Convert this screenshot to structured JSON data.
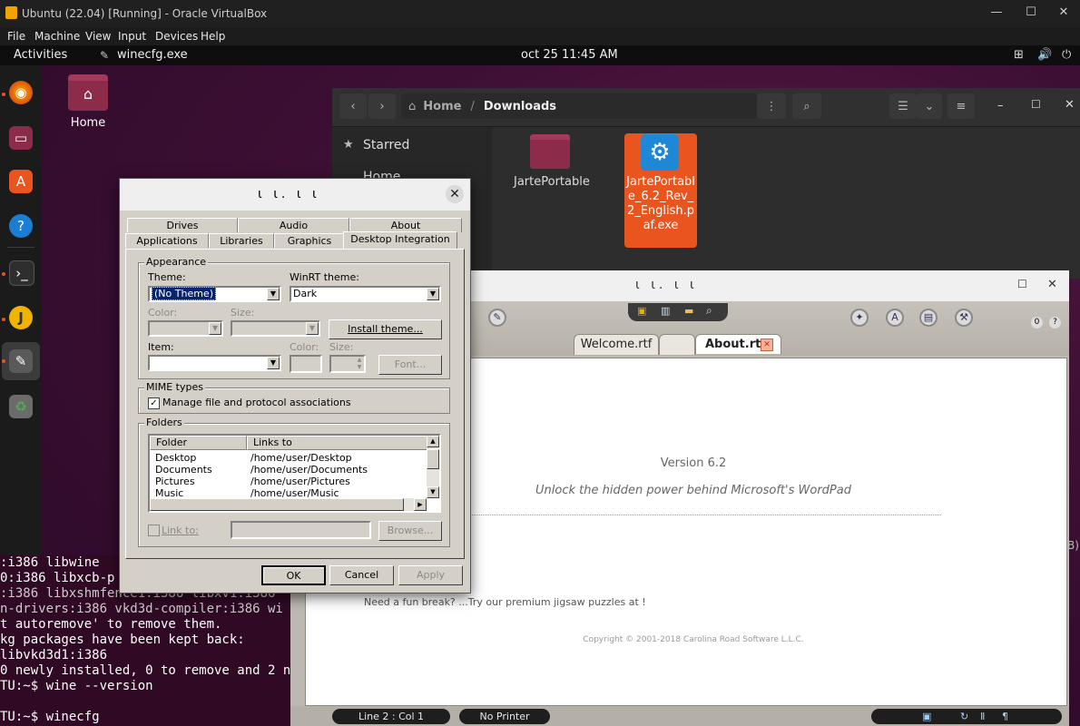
{
  "vbox": {
    "title": "Ubuntu (22.04) [Running] - Oracle VirtualBox",
    "menu": [
      "File",
      "Machine",
      "View",
      "Input",
      "Devices",
      "Help"
    ],
    "controls": {
      "minimize": "—",
      "maximize": "☐",
      "close": "✕"
    }
  },
  "gnome": {
    "activities": "Activities",
    "app_name": "winecfg.exe",
    "clock": "oct 25  11:45 AM",
    "tray": {
      "network": "⊞",
      "volume": "🔊",
      "power": "⏻"
    }
  },
  "desktop": {
    "home_label": "Home"
  },
  "terminal": {
    "lines": [
      ":i386 libwine",
      "0:i386 libxcb-p",
      ":i386 libxshmfence1:i386 libxv1:i386",
      "n-drivers:i386 vkd3d-compiler:i386 wi",
      "t autoremove' to remove them.",
      "kg packages have been kept back:",
      "libvkd3d1:i386",
      "0 newly installed, 0 to remove and 2 n",
      "TU:~$ wine --version",
      "",
      "TU:~$ winecfg"
    ]
  },
  "nautilus": {
    "breadcrumb_home": "Home",
    "breadcrumb_sep": "/",
    "breadcrumb_current": "Downloads",
    "sidebar": {
      "starred": "Starred",
      "home": "Home"
    },
    "files": [
      {
        "name": "JartePortable",
        "type": "folder"
      },
      {
        "name": "JartePortable_6.2_Rev_2_English.paf.exe",
        "type": "exe",
        "selected": true
      }
    ]
  },
  "jarte": {
    "title": "ι ι. ι ι",
    "tabs": [
      "Welcome.rtf",
      "",
      "About.rtf"
    ],
    "version": "Version 6.2",
    "tagline": "Unlock the hidden power behind Microsoft's WordPad",
    "fun_break": "Need a fun break?  ...Try our premium jigsaw puzzles at !",
    "copyright": "Copyright © 2001-2018 Carolina Road Software L.L.C.",
    "status_line": "Line 2 : Col 1",
    "status_printer": "No Printer",
    "side_fragment": "B)"
  },
  "winecfg": {
    "title": "ι ι. ι ι",
    "tabs_row1": [
      "Drives",
      "Audio",
      "About"
    ],
    "tabs_row2": [
      "Applications",
      "Libraries",
      "Graphics",
      "Desktop Integration"
    ],
    "active_tab": "Desktop Integration",
    "appearance": {
      "group": "Appearance",
      "theme_label": "Theme:",
      "theme_value": "(No Theme)",
      "winrt_label": "WinRT theme:",
      "winrt_value": "Dark",
      "color_label": "Color:",
      "size_label": "Size:",
      "install_button": "Install theme...",
      "item_label": "Item:",
      "item_color_label": "Color:",
      "item_size_label": "Size:",
      "font_button": "Font..."
    },
    "mime": {
      "group": "MIME types",
      "checkbox_label": "Manage file and protocol associations",
      "checked": true
    },
    "folders": {
      "group": "Folders",
      "col_folder": "Folder",
      "col_links": "Links to",
      "rows": [
        {
          "folder": "Desktop",
          "link": "/home/user/Desktop"
        },
        {
          "folder": "Documents",
          "link": "/home/user/Documents"
        },
        {
          "folder": "Pictures",
          "link": "/home/user/Pictures"
        },
        {
          "folder": "Music",
          "link": "/home/user/Music"
        }
      ],
      "link_to_label": "Link to:",
      "browse_button": "Browse..."
    },
    "buttons": {
      "ok": "OK",
      "cancel": "Cancel",
      "apply": "Apply"
    }
  }
}
